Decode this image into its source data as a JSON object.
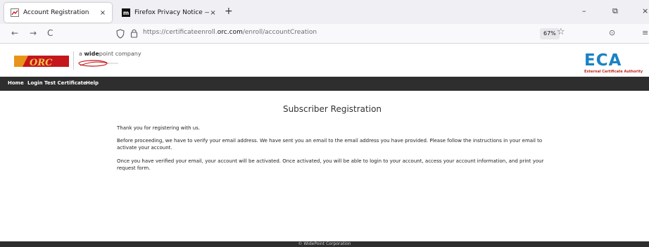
{
  "browser": {
    "tabs": [
      {
        "title": "Account Registration",
        "close_glyph": "×"
      },
      {
        "title": "Firefox Privacy Notice — Mozill",
        "close_glyph": "×"
      }
    ],
    "new_tab_glyph": "+",
    "window_controls": {
      "minimize": "–",
      "restore": "⧉",
      "close": "×"
    },
    "nav": {
      "back": "←",
      "forward": "→",
      "reload": "C"
    },
    "url": {
      "prefix": "https://certificateenroll.",
      "domain": "orc.com",
      "path": "/enroll/accountCreation"
    },
    "zoom": "67%",
    "bookmark_glyph": "☆",
    "pocket_glyph": "⊙",
    "menu_glyph": "≡"
  },
  "header": {
    "partner_prefix": "a ",
    "partner_brand": "wide",
    "partner_suffix": "point company",
    "orc_logo_text": "ORC",
    "eca_title": "ECA",
    "eca_subtitle": "External Certificate Authority"
  },
  "menu": {
    "items": [
      "Home",
      "Login",
      "Test Certificate",
      "Help"
    ]
  },
  "content": {
    "title": "Subscriber Registration",
    "paragraphs": [
      "Thank you for registering with us.",
      "Before proceeding, we have to verify your email address. We have sent you an email to the email address you have provided. Please follow the instructions in your email to activate your account.",
      "Once you have verified your email, your account will be activated.  Once activated, you will be able to login to your account, access your account information, and print your request form."
    ]
  },
  "footer": {
    "text": "© WidePoint Corporation"
  },
  "colors": {
    "menubar": "#2e2e2e",
    "eca_blue": "#1a82c4",
    "eca_red": "#c0241a",
    "orc_orange": "#e8941a",
    "orc_red": "#c4161c"
  }
}
